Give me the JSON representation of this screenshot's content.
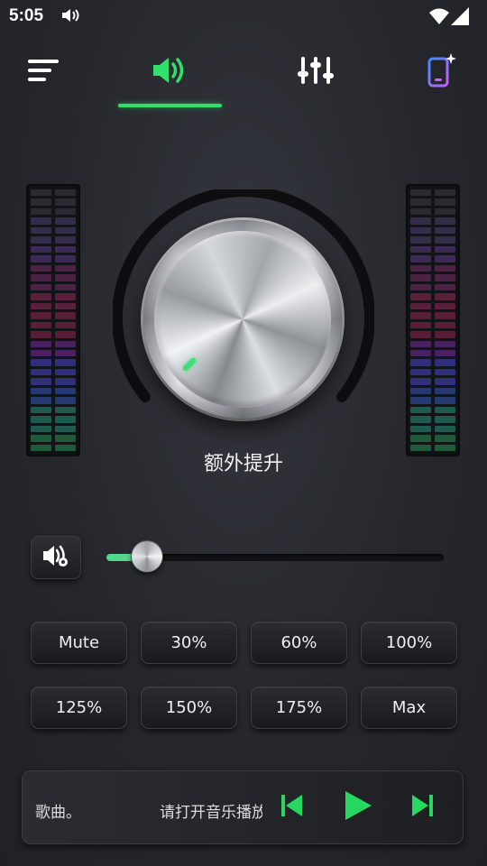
{
  "status_bar": {
    "time": "5:05"
  },
  "nav": {
    "items": [
      "menu-icon",
      "volume-boost-icon",
      "equalizer-icon",
      "phone-theme-icon"
    ],
    "active_index": 1,
    "accent_color": "#2fe06a"
  },
  "knob": {
    "label": "额外提升",
    "marker_color": "#3fe07c"
  },
  "slider": {
    "level_percent": 12
  },
  "presets": {
    "row1": [
      "Mute",
      "30%",
      "60%",
      "100%"
    ],
    "row2": [
      "125%",
      "150%",
      "175%",
      "Max"
    ]
  },
  "player": {
    "song_title": "歌曲。",
    "status_text": "请打开音乐播放",
    "controls": [
      "previous-icon",
      "play-icon",
      "next-icon"
    ],
    "control_color": "#27d860"
  },
  "vu_colors": [
    "#2a2a33",
    "#352c4a",
    "#3a2a55",
    "#4a2244",
    "#58203a",
    "#5a1e34",
    "#4a2060",
    "#2f2f7a",
    "#243a70",
    "#1f5a4e",
    "#1f5a3a"
  ]
}
